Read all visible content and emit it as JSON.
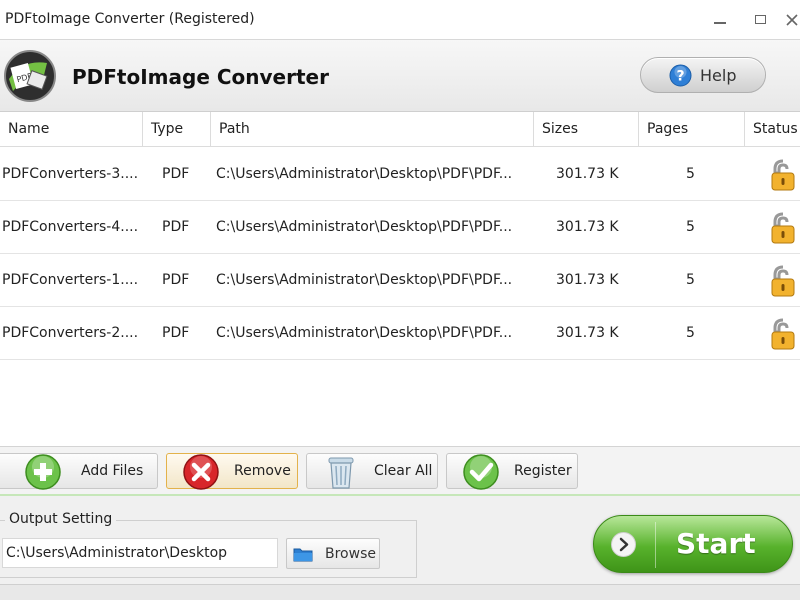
{
  "window": {
    "title": "PDFtoImage Converter (Registered)"
  },
  "header": {
    "app_name": "PDFtoImage Converter",
    "logo_text": "PDF",
    "help_label": "Help"
  },
  "table": {
    "columns": [
      "Name",
      "Type",
      "Path",
      "Sizes",
      "Pages",
      "Status"
    ],
    "rows": [
      {
        "name": "PDFConverters-3....",
        "type": "PDF",
        "path": "C:\\Users\\Administrator\\Desktop\\PDF\\PDF...",
        "size": "301.73 K",
        "pages": "5",
        "status_icon": "unlocked-padlock-icon"
      },
      {
        "name": "PDFConverters-4....",
        "type": "PDF",
        "path": "C:\\Users\\Administrator\\Desktop\\PDF\\PDF...",
        "size": "301.73 K",
        "pages": "5",
        "status_icon": "unlocked-padlock-icon"
      },
      {
        "name": "PDFConverters-1....",
        "type": "PDF",
        "path": "C:\\Users\\Administrator\\Desktop\\PDF\\PDF...",
        "size": "301.73 K",
        "pages": "5",
        "status_icon": "unlocked-padlock-icon"
      },
      {
        "name": "PDFConverters-2....",
        "type": "PDF",
        "path": "C:\\Users\\Administrator\\Desktop\\PDF\\PDF...",
        "size": "301.73 K",
        "pages": "5",
        "status_icon": "unlocked-padlock-icon"
      }
    ]
  },
  "toolbar": {
    "add_files": "Add Files",
    "remove": "Remove",
    "clear_all": "Clear All",
    "register": "Register"
  },
  "output": {
    "group_title": "Output Setting",
    "path_value": "C:\\Users\\Administrator\\Desktop",
    "browse_label": "Browse"
  },
  "start": {
    "label": "Start"
  },
  "colors": {
    "accent_green": "#58b22c",
    "remove_red": "#d8262a",
    "lock_gold": "#f2b22e",
    "help_blue": "#2f7fd6"
  }
}
